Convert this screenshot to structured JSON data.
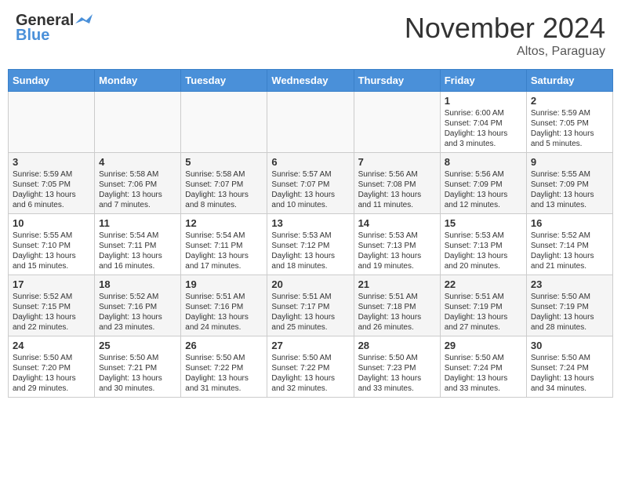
{
  "header": {
    "logo_general": "General",
    "logo_blue": "Blue",
    "month_title": "November 2024",
    "location": "Altos, Paraguay"
  },
  "days_of_week": [
    "Sunday",
    "Monday",
    "Tuesday",
    "Wednesday",
    "Thursday",
    "Friday",
    "Saturday"
  ],
  "weeks": [
    {
      "days": [
        {
          "date": "",
          "info": ""
        },
        {
          "date": "",
          "info": ""
        },
        {
          "date": "",
          "info": ""
        },
        {
          "date": "",
          "info": ""
        },
        {
          "date": "",
          "info": ""
        },
        {
          "date": "1",
          "info": "Sunrise: 6:00 AM\nSunset: 7:04 PM\nDaylight: 13 hours\nand 3 minutes."
        },
        {
          "date": "2",
          "info": "Sunrise: 5:59 AM\nSunset: 7:05 PM\nDaylight: 13 hours\nand 5 minutes."
        }
      ]
    },
    {
      "days": [
        {
          "date": "3",
          "info": "Sunrise: 5:59 AM\nSunset: 7:05 PM\nDaylight: 13 hours\nand 6 minutes."
        },
        {
          "date": "4",
          "info": "Sunrise: 5:58 AM\nSunset: 7:06 PM\nDaylight: 13 hours\nand 7 minutes."
        },
        {
          "date": "5",
          "info": "Sunrise: 5:58 AM\nSunset: 7:07 PM\nDaylight: 13 hours\nand 8 minutes."
        },
        {
          "date": "6",
          "info": "Sunrise: 5:57 AM\nSunset: 7:07 PM\nDaylight: 13 hours\nand 10 minutes."
        },
        {
          "date": "7",
          "info": "Sunrise: 5:56 AM\nSunset: 7:08 PM\nDaylight: 13 hours\nand 11 minutes."
        },
        {
          "date": "8",
          "info": "Sunrise: 5:56 AM\nSunset: 7:09 PM\nDaylight: 13 hours\nand 12 minutes."
        },
        {
          "date": "9",
          "info": "Sunrise: 5:55 AM\nSunset: 7:09 PM\nDaylight: 13 hours\nand 13 minutes."
        }
      ]
    },
    {
      "days": [
        {
          "date": "10",
          "info": "Sunrise: 5:55 AM\nSunset: 7:10 PM\nDaylight: 13 hours\nand 15 minutes."
        },
        {
          "date": "11",
          "info": "Sunrise: 5:54 AM\nSunset: 7:11 PM\nDaylight: 13 hours\nand 16 minutes."
        },
        {
          "date": "12",
          "info": "Sunrise: 5:54 AM\nSunset: 7:11 PM\nDaylight: 13 hours\nand 17 minutes."
        },
        {
          "date": "13",
          "info": "Sunrise: 5:53 AM\nSunset: 7:12 PM\nDaylight: 13 hours\nand 18 minutes."
        },
        {
          "date": "14",
          "info": "Sunrise: 5:53 AM\nSunset: 7:13 PM\nDaylight: 13 hours\nand 19 minutes."
        },
        {
          "date": "15",
          "info": "Sunrise: 5:53 AM\nSunset: 7:13 PM\nDaylight: 13 hours\nand 20 minutes."
        },
        {
          "date": "16",
          "info": "Sunrise: 5:52 AM\nSunset: 7:14 PM\nDaylight: 13 hours\nand 21 minutes."
        }
      ]
    },
    {
      "days": [
        {
          "date": "17",
          "info": "Sunrise: 5:52 AM\nSunset: 7:15 PM\nDaylight: 13 hours\nand 22 minutes."
        },
        {
          "date": "18",
          "info": "Sunrise: 5:52 AM\nSunset: 7:16 PM\nDaylight: 13 hours\nand 23 minutes."
        },
        {
          "date": "19",
          "info": "Sunrise: 5:51 AM\nSunset: 7:16 PM\nDaylight: 13 hours\nand 24 minutes."
        },
        {
          "date": "20",
          "info": "Sunrise: 5:51 AM\nSunset: 7:17 PM\nDaylight: 13 hours\nand 25 minutes."
        },
        {
          "date": "21",
          "info": "Sunrise: 5:51 AM\nSunset: 7:18 PM\nDaylight: 13 hours\nand 26 minutes."
        },
        {
          "date": "22",
          "info": "Sunrise: 5:51 AM\nSunset: 7:19 PM\nDaylight: 13 hours\nand 27 minutes."
        },
        {
          "date": "23",
          "info": "Sunrise: 5:50 AM\nSunset: 7:19 PM\nDaylight: 13 hours\nand 28 minutes."
        }
      ]
    },
    {
      "days": [
        {
          "date": "24",
          "info": "Sunrise: 5:50 AM\nSunset: 7:20 PM\nDaylight: 13 hours\nand 29 minutes."
        },
        {
          "date": "25",
          "info": "Sunrise: 5:50 AM\nSunset: 7:21 PM\nDaylight: 13 hours\nand 30 minutes."
        },
        {
          "date": "26",
          "info": "Sunrise: 5:50 AM\nSunset: 7:22 PM\nDaylight: 13 hours\nand 31 minutes."
        },
        {
          "date": "27",
          "info": "Sunrise: 5:50 AM\nSunset: 7:22 PM\nDaylight: 13 hours\nand 32 minutes."
        },
        {
          "date": "28",
          "info": "Sunrise: 5:50 AM\nSunset: 7:23 PM\nDaylight: 13 hours\nand 33 minutes."
        },
        {
          "date": "29",
          "info": "Sunrise: 5:50 AM\nSunset: 7:24 PM\nDaylight: 13 hours\nand 33 minutes."
        },
        {
          "date": "30",
          "info": "Sunrise: 5:50 AM\nSunset: 7:24 PM\nDaylight: 13 hours\nand 34 minutes."
        }
      ]
    }
  ]
}
